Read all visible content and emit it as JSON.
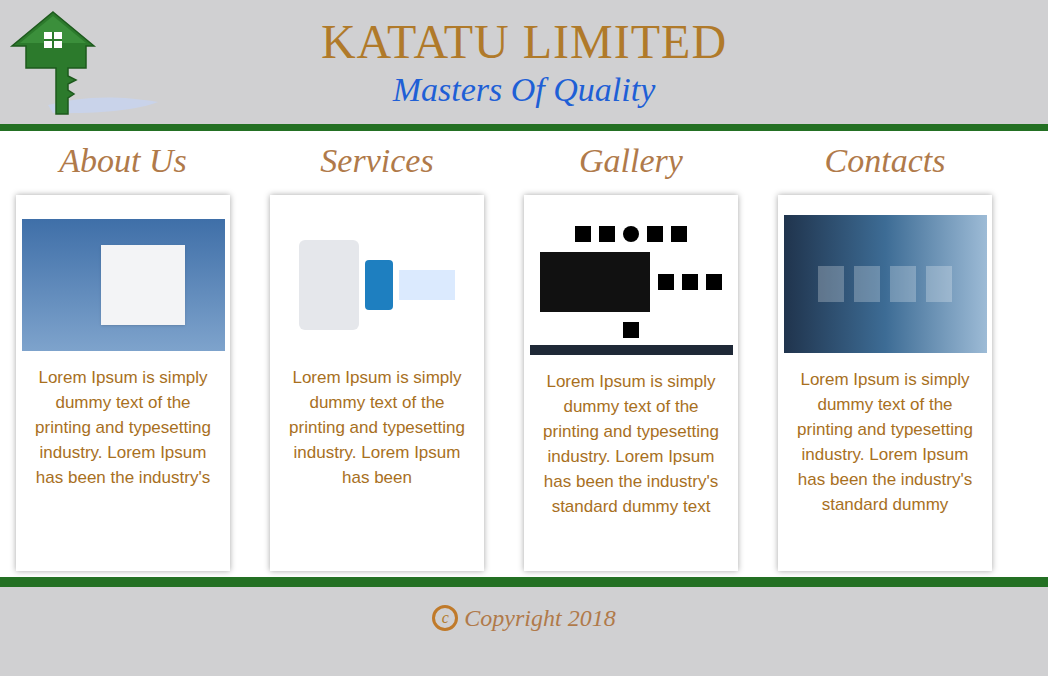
{
  "header": {
    "title": "KATATU LIMITED",
    "tagline": "Masters Of Quality"
  },
  "sections": [
    {
      "heading": "About Us",
      "text": "Lorem Ipsum is simply dummy text of the printing and typesetting industry. Lorem Ipsum has been the industry's",
      "kind": "photo"
    },
    {
      "heading": "Services",
      "text": "Lorem Ipsum is simply dummy text of the printing and typesetting industry. Lorem Ipsum has been",
      "kind": "illustration"
    },
    {
      "heading": "Gallery",
      "text": "Lorem Ipsum is simply dummy text of the printing and typesetting industry. Lorem Ipsum has been the industry's standard dummy text",
      "kind": "icons"
    },
    {
      "heading": "Contacts",
      "text": "Lorem Ipsum is simply dummy text of the printing and typesetting industry. Lorem Ipsum has been the industry's standard dummy",
      "kind": "photo-dark"
    }
  ],
  "footer": {
    "symbol": "c",
    "text": "Copyright 2018"
  }
}
